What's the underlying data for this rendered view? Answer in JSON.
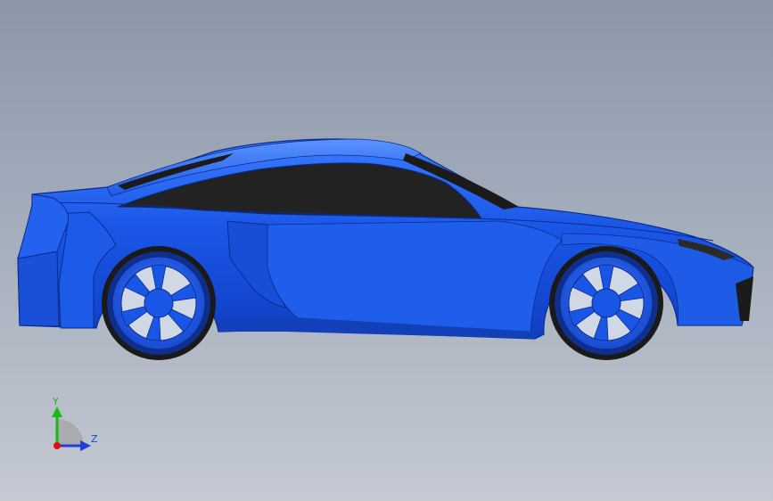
{
  "viewport": {
    "background_top": "#8c96a8",
    "background_bottom": "#c4c9d2"
  },
  "model": {
    "body_color": "#1a56e6",
    "glass_color": "#222222",
    "edge_color": "#0a2c8c"
  },
  "triad": {
    "y_label": "Y",
    "z_label": "Z",
    "y_color": "#17b817",
    "z_color": "#1f3fd8",
    "origin_color": "#e01010"
  }
}
